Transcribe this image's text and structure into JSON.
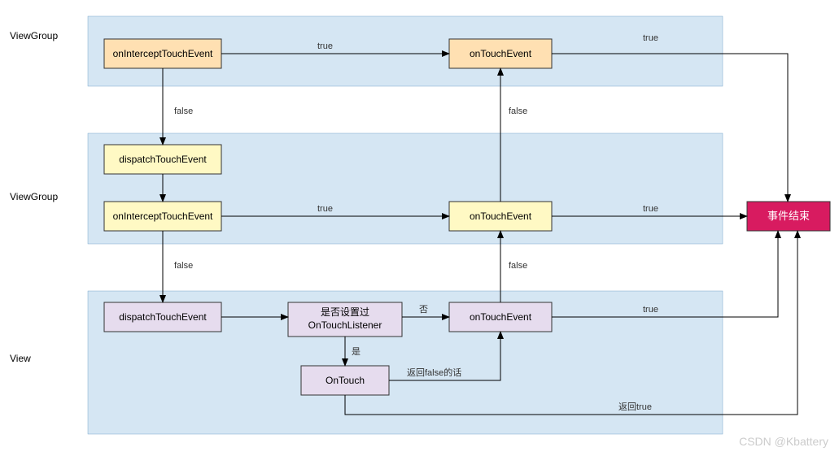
{
  "chart_data": {
    "type": "flowchart",
    "title": "",
    "lanes": [
      {
        "name": "ViewGroup"
      },
      {
        "name": "ViewGroup"
      },
      {
        "name": "View"
      }
    ],
    "nodes": [
      {
        "id": "vg1_int",
        "lane": 0,
        "label": "onInterceptTouchEvent",
        "style": "orange"
      },
      {
        "id": "vg1_ote",
        "lane": 0,
        "label": "onTouchEvent",
        "style": "orange"
      },
      {
        "id": "vg2_disp",
        "lane": 1,
        "label": "dispatchTouchEvent",
        "style": "yellow"
      },
      {
        "id": "vg2_int",
        "lane": 1,
        "label": "onInterceptTouchEvent",
        "style": "yellow"
      },
      {
        "id": "vg2_ote",
        "lane": 1,
        "label": "onTouchEvent",
        "style": "yellow"
      },
      {
        "id": "v_disp",
        "lane": 2,
        "label": "dispatchTouchEvent",
        "style": "purple"
      },
      {
        "id": "v_listener",
        "lane": 2,
        "label": "是否设置过\nOnTouchListener",
        "style": "purple"
      },
      {
        "id": "v_ote",
        "lane": 2,
        "label": "onTouchEvent",
        "style": "purple"
      },
      {
        "id": "v_ontouch",
        "lane": 2,
        "label": "OnTouch",
        "style": "purple"
      },
      {
        "id": "end",
        "lane": -1,
        "label": "事件结束",
        "style": "pink"
      }
    ],
    "edges": [
      {
        "from": "vg1_int",
        "to": "vg1_ote",
        "label": "true"
      },
      {
        "from": "vg1_int",
        "to": "vg2_disp",
        "label": "false"
      },
      {
        "from": "vg1_ote",
        "to": "end",
        "label": "true"
      },
      {
        "from": "vg2_disp",
        "to": "vg2_int",
        "label": ""
      },
      {
        "from": "vg2_int",
        "to": "vg2_ote",
        "label": "true"
      },
      {
        "from": "vg2_int",
        "to": "v_disp",
        "label": "false"
      },
      {
        "from": "vg2_ote",
        "to": "vg1_ote",
        "label": "false"
      },
      {
        "from": "vg2_ote",
        "to": "end",
        "label": "true"
      },
      {
        "from": "v_disp",
        "to": "v_listener",
        "label": ""
      },
      {
        "from": "v_listener",
        "to": "v_ote",
        "label": "否"
      },
      {
        "from": "v_listener",
        "to": "v_ontouch",
        "label": "是"
      },
      {
        "from": "v_ontouch",
        "to": "v_ote",
        "label": "返回false的话"
      },
      {
        "from": "v_ontouch",
        "to": "end",
        "label": "返回true"
      },
      {
        "from": "v_ote",
        "to": "vg2_ote",
        "label": "false"
      },
      {
        "from": "v_ote",
        "to": "end",
        "label": "true"
      }
    ]
  },
  "labels": {
    "lane1": "ViewGroup",
    "lane2": "ViewGroup",
    "lane3": "View",
    "vg1_int": "onInterceptTouchEvent",
    "vg1_ote": "onTouchEvent",
    "vg2_disp": "dispatchTouchEvent",
    "vg2_int": "onInterceptTouchEvent",
    "vg2_ote": "onTouchEvent",
    "v_disp": "dispatchTouchEvent",
    "v_listener_l1": "是否设置过",
    "v_listener_l2": "OnTouchListener",
    "v_ote": "onTouchEvent",
    "v_ontouch": "OnTouch",
    "end": "事件结束",
    "e_true": "true",
    "e_false": "false",
    "e_no": "否",
    "e_yes": "是",
    "e_retfalse": "返回false的话",
    "e_rettrue": "返回true",
    "watermark": "CSDN @Kbattery"
  }
}
